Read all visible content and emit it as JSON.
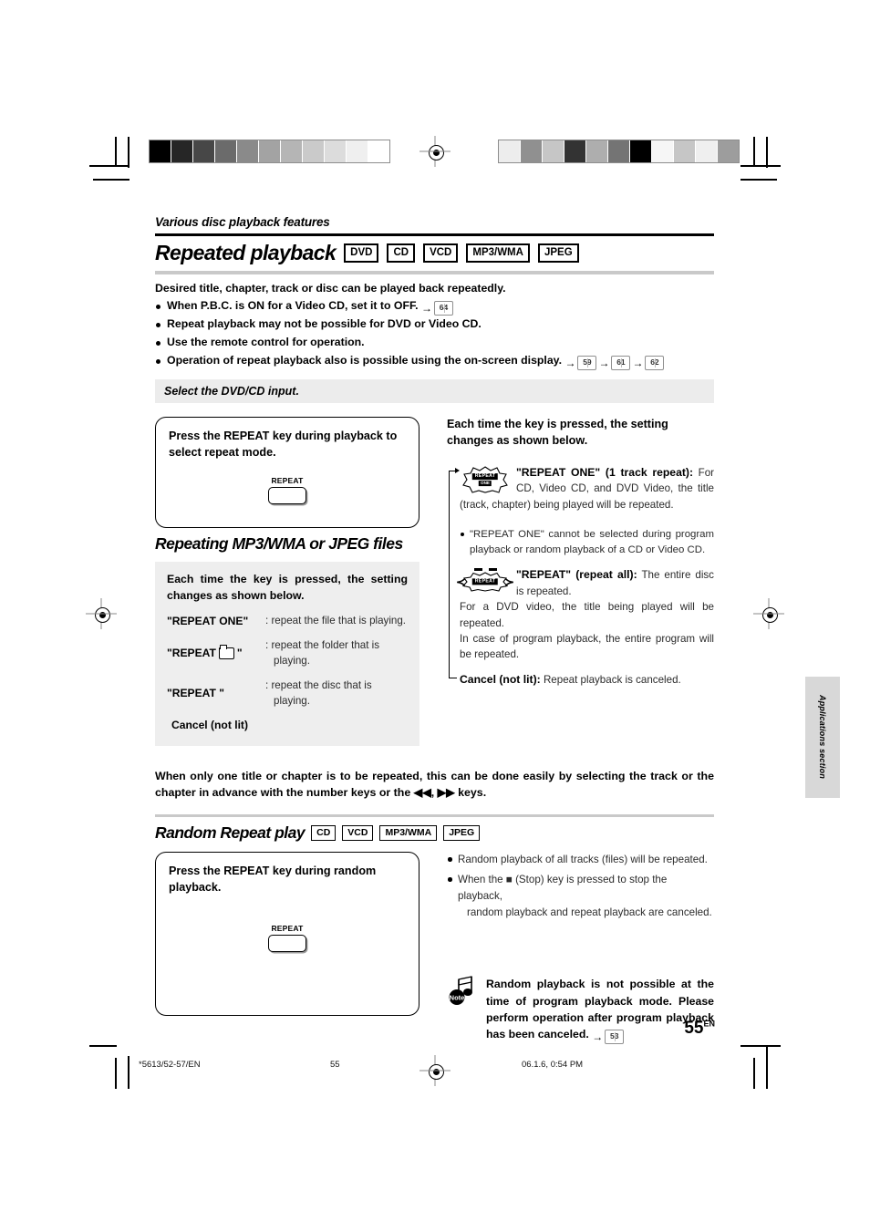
{
  "section": {
    "heading": "Various disc playback features"
  },
  "main": {
    "title": "Repeated playback",
    "formats": [
      "DVD",
      "CD",
      "VCD",
      "MP3/WMA",
      "JPEG"
    ],
    "lead": "Desired title, chapter, track or disc can be played back repeatedly.",
    "bullets": [
      {
        "text": "When P.B.C. is ON for a Video CD, set it to OFF.",
        "refs": [
          "64"
        ]
      },
      {
        "text": "Repeat playback may not be possible for DVD or Video CD.",
        "refs": []
      },
      {
        "text": "Use the remote control for operation.",
        "refs": []
      },
      {
        "text": "Operation of repeat playback also is possible using the on-screen display.",
        "refs": [
          "59",
          "61",
          "62"
        ]
      }
    ],
    "input_bar": "Select the DVD/CD input."
  },
  "step_box": {
    "instruction": "Press the REPEAT key during playback to select repeat mode.",
    "key_label": "REPEAT"
  },
  "right_column": {
    "lead": "Each time the key is pressed, the setting changes as shown below.",
    "items": [
      {
        "badge": {
          "word1": "REPEAT",
          "word2": "ONE",
          "dashes": false,
          "arcs": false
        },
        "title": "\"REPEAT ONE\" (1 track repeat):",
        "body": "For CD, Video CD, and DVD Video, the title (track, chapter) being played will be repeated."
      },
      {
        "badge": {
          "word1": "REPEAT",
          "word2": "",
          "dashes": true,
          "arcs": true
        },
        "title": "\"REPEAT\" (repeat all):",
        "body": "The entire disc is repeated.",
        "body2": "For a DVD video, the title being played will be repeated.",
        "body3": "In case of program playback, the entire program will be repeated."
      }
    ],
    "sub_bullet": "\"REPEAT ONE\" cannot be selected during program playback or random playback of a CD or Video CD.",
    "cancel_title": "Cancel (not lit):",
    "cancel_body": "Repeat playback is canceled."
  },
  "mp3_section": {
    "heading": "Repeating MP3/WMA or JPEG files",
    "intro": "Each time the key is pressed, the setting changes as shown below.",
    "rows": [
      {
        "key": "\"REPEAT ONE\"",
        "icon": "",
        "value": ": repeat the file that is playing.",
        "cont": ""
      },
      {
        "key": "\"REPEAT",
        "icon": "folder-icon",
        "key_end": "\"",
        "value": ": repeat the folder that is",
        "cont": "playing."
      },
      {
        "key": "\"REPEAT \"",
        "icon": "",
        "value": ": repeat the disc that is",
        "cont": "playing."
      }
    ],
    "cancel": "Cancel (not lit)"
  },
  "mid_note": "When only one title or chapter is to be repeated, this can be done easily by selecting the track or the chapter in advance with the number keys or the ◀◀, ▶▶ keys.",
  "random": {
    "title": "Random Repeat play",
    "formats": [
      "CD",
      "VCD",
      "MP3/WMA",
      "JPEG"
    ],
    "box_instruction": "Press the REPEAT key during random playback.",
    "key_label": "REPEAT",
    "bullets": [
      {
        "text": "Random playback of all tracks (files) will be repeated.",
        "cont": ""
      },
      {
        "text": "When the ■ (Stop) key is pressed to stop the playback,",
        "cont": "random playback and repeat playback are canceled."
      }
    ]
  },
  "note": {
    "icon_label": "Note",
    "text": "Random playback is not possible at the time of program playback mode. Please perform operation after program playback has been canceled.",
    "ref": "53"
  },
  "side_tab": "Applications section",
  "page": {
    "number": "55",
    "lang": "EN"
  },
  "footer": {
    "file": "*5613/52-57/EN",
    "page": "55",
    "timestamp": "06.1.6, 0:54 PM"
  },
  "colorbars": {
    "left": [
      "#000000",
      "#262626",
      "#474747",
      "#6b6b6b",
      "#8a8a8a",
      "#a3a3a3",
      "#b5b5b5",
      "#cacaca",
      "#dcdcdc",
      "#efefef",
      "#ffffff"
    ],
    "right": [
      "#ededed",
      "#909090",
      "#c6c6c6",
      "#333333",
      "#aeaeae",
      "#747474",
      "#000000",
      "#f6f6f6",
      "#c6c6c6",
      "#efefef",
      "#9d9d9d"
    ]
  }
}
